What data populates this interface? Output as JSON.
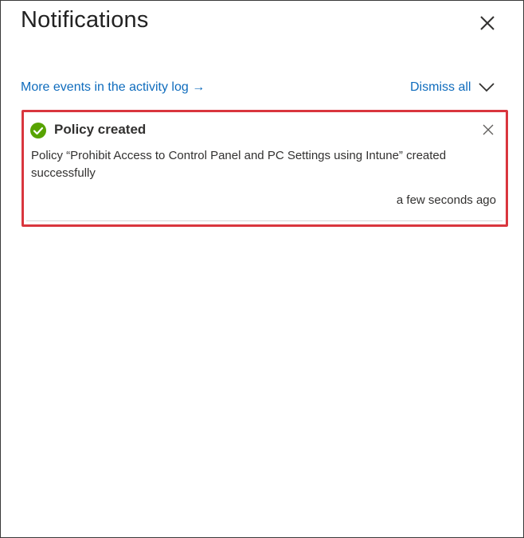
{
  "panel": {
    "title": "Notifications",
    "activity_link": "More events in the activity log →",
    "dismiss_all": "Dismiss all"
  },
  "notifications": [
    {
      "status": "success",
      "status_color": "#57a300",
      "title": "Policy created",
      "message": "Policy “Prohibit Access to Control Panel and PC Settings using Intune” created successfully",
      "time": "a few seconds ago"
    }
  ],
  "colors": {
    "link": "#0f6cbd",
    "highlight_border": "#d9363e"
  }
}
